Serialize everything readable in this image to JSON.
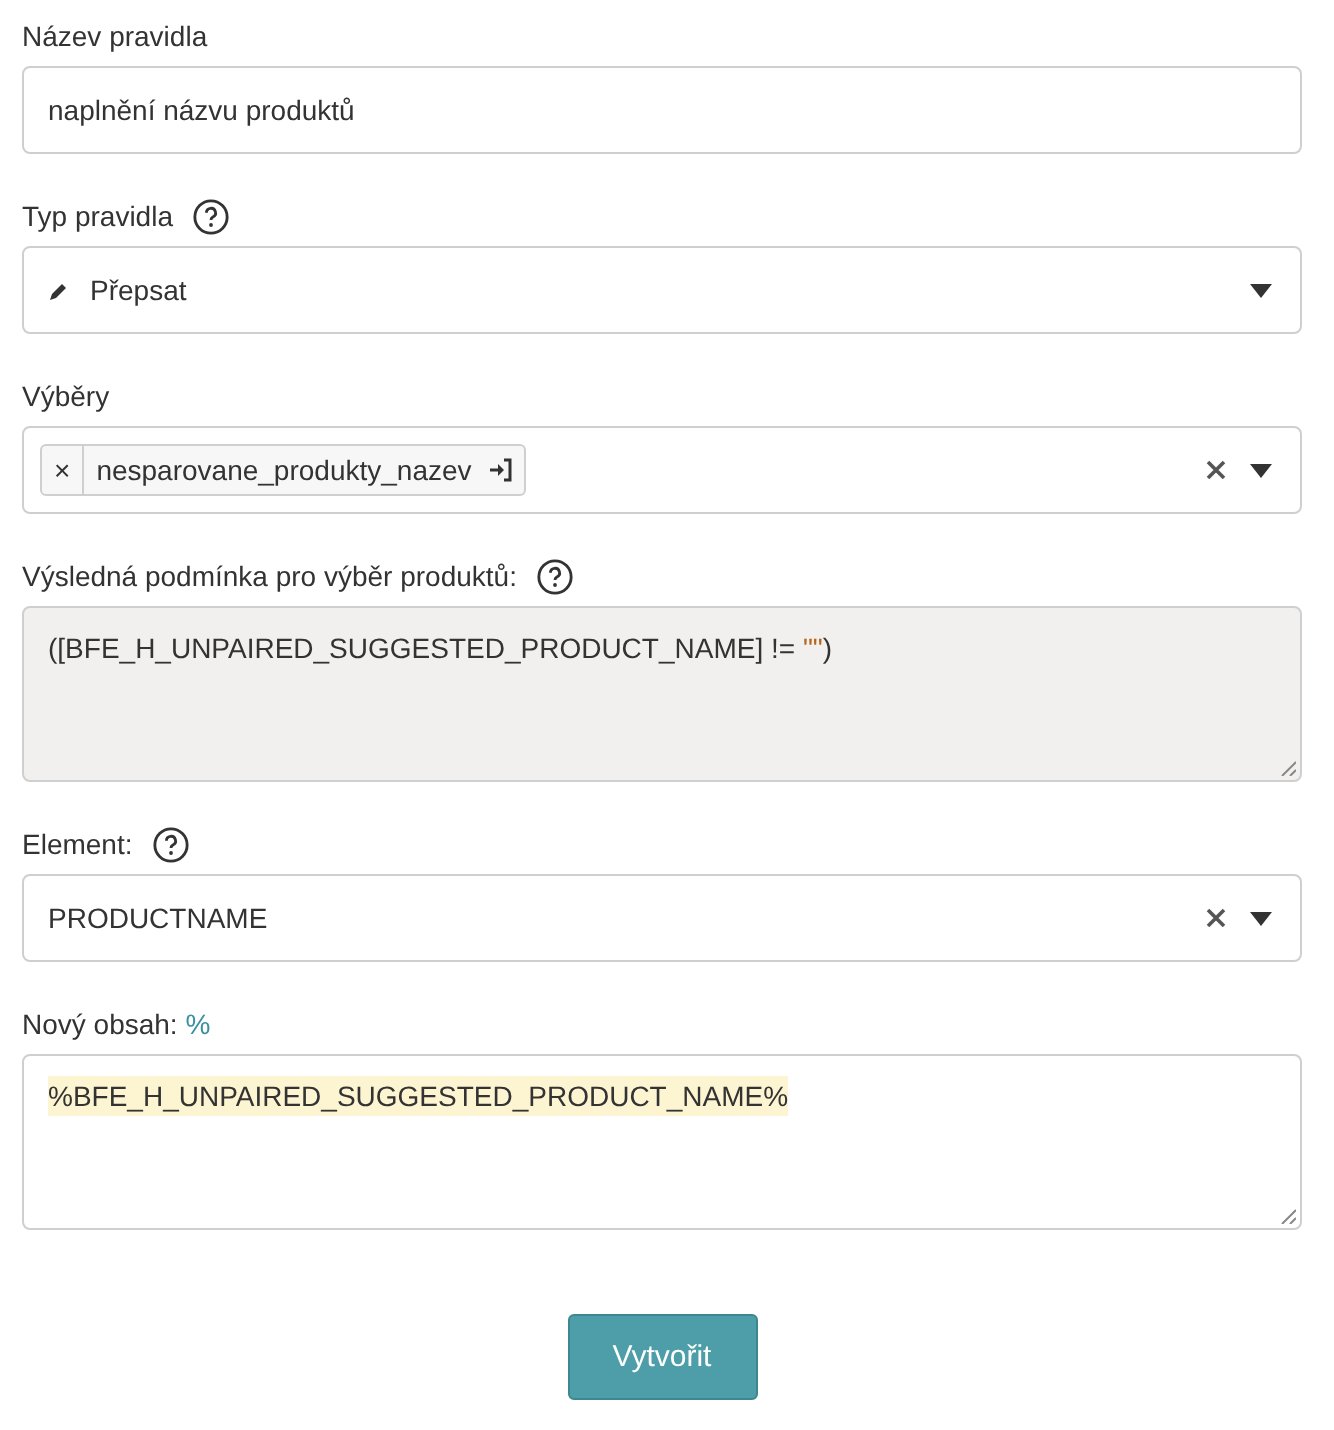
{
  "fields": [
    {
      "kind": "text",
      "label": "Název pravidla",
      "help": false,
      "value": "naplnění názvu produktů"
    },
    {
      "kind": "select",
      "label": "Typ pravidla",
      "help": true,
      "value": "Přepsat",
      "clearable": false
    },
    {
      "kind": "multiselect",
      "label": "Výběry",
      "help": false,
      "tags": [
        {
          "remove": "×",
          "text": "nesparovane_produkty_nazev"
        }
      ],
      "clearable": true
    },
    {
      "kind": "readonly_textarea",
      "label": "Výsledná podmínka pro výběr produktů:",
      "help": true,
      "parts": [
        {
          "kind": "plain",
          "text": "([BFE_H_UNPAIRED_SUGGESTED_PRODUCT_NAME] != "
        },
        {
          "kind": "string",
          "text": "\"\""
        },
        {
          "kind": "plain",
          "text": ")"
        }
      ]
    },
    {
      "kind": "select",
      "label": "Element:",
      "help": true,
      "value": "PRODUCTNAME",
      "clearable": true
    },
    {
      "kind": "textarea",
      "label": "Nový obsah:",
      "hint": "%",
      "help": false,
      "value": "%BFE_H_UNPAIRED_SUGGESTED_PRODUCT_NAME%",
      "highlighted": true
    }
  ],
  "submit": "Vytvořit"
}
